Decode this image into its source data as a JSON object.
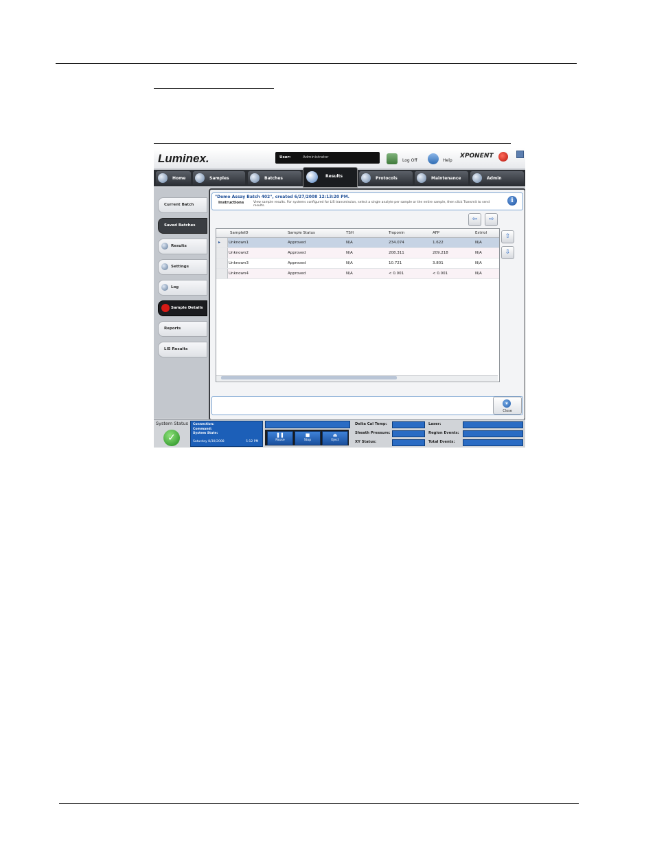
{
  "document": {},
  "app": {
    "brand": "Luminex.",
    "product": "XPONENT",
    "user_label": "User:",
    "user_value": "Administrator",
    "logoff_label": "Log Off",
    "help_label": "Help",
    "nav_tabs": [
      {
        "label": "Home"
      },
      {
        "label": "Samples"
      },
      {
        "label": "Batches"
      },
      {
        "label": "Results",
        "active": true
      },
      {
        "label": "Protocols"
      },
      {
        "label": "Maintenance"
      },
      {
        "label": "Admin"
      }
    ],
    "sidebar": [
      {
        "label": "Current Batch"
      },
      {
        "label": "Saved Batches",
        "selected": true
      },
      {
        "label": "Results"
      },
      {
        "label": "Settings"
      },
      {
        "label": "Log"
      },
      {
        "label": "Sample Details",
        "active": true
      },
      {
        "label": "Reports"
      },
      {
        "label": "LIS Results"
      }
    ],
    "batch_title": "\"Demo Assay Batch 402\", created 6/27/2008 12:13:20 PM.",
    "instructions_label": "Instructions",
    "instructions_text": "View sample results. For systems configured for LIS transmission, select a single analyte per sample or the entire sample, then click Transmit to send results.",
    "info_icon_glyph": "i",
    "nav_arrows": {
      "left": "⇦",
      "right": "⇨",
      "up": "⇧",
      "down": "⇩"
    },
    "table": {
      "columns": [
        "SampleID",
        "Sample Status",
        "TSH",
        "Troponin",
        "AFP",
        "Estriol"
      ],
      "rows": [
        [
          "Unknown1",
          "Approved",
          "N/A",
          "234.074",
          "1.622",
          "N/A"
        ],
        [
          "Unknown2",
          "Approved",
          "N/A",
          "208.311",
          "209.218",
          "N/A"
        ],
        [
          "Unknown3",
          "Approved",
          "N/A",
          "10.721",
          "3.801",
          "N/A"
        ],
        [
          "Unknown4",
          "Approved",
          "N/A",
          "< 0.001",
          "< 0.001",
          "N/A"
        ]
      ]
    },
    "close_label": "Close",
    "status": {
      "system_status_label": "System Status",
      "connection": "Connection:",
      "command": "Command:",
      "system_state": "System State:",
      "date": "Saturday 8/30/2008",
      "time": "5:12 PM",
      "buttons": [
        "Pause",
        "Stop",
        "Eject"
      ],
      "metrics_left": [
        "Delta Cal Temp:",
        "Sheath Pressure:",
        "XY Status:"
      ],
      "metrics_right": [
        "Laser:",
        "Region Events:",
        "Total Events:"
      ]
    },
    "colors": {
      "accent": "#1c5fb8",
      "title_blue": "#1f4f97",
      "alert_red": "#d61a15",
      "ok_green": "#1f8a1c"
    }
  }
}
